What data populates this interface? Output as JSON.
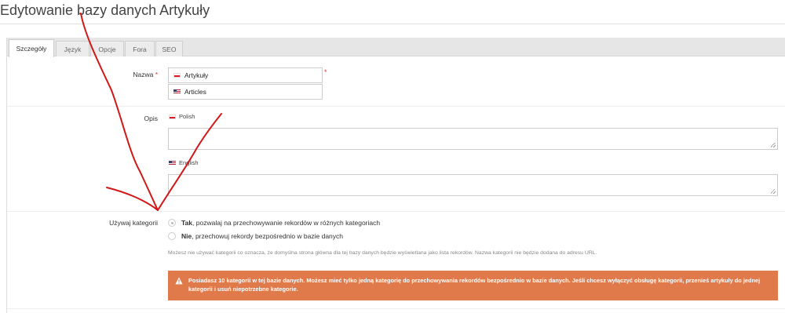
{
  "page": {
    "title": "Edytowanie bazy danych Artykuły"
  },
  "tabs": [
    {
      "label": "Szczegóły",
      "active": true
    },
    {
      "label": "Język"
    },
    {
      "label": "Opcje"
    },
    {
      "label": "Fora"
    },
    {
      "label": "SEO"
    }
  ],
  "name_field": {
    "label": "Nazwa",
    "required_mark": "*",
    "pl_value": "Artykuły",
    "en_value": "Articles"
  },
  "description_field": {
    "label": "Opis",
    "pl_lang": "Polish",
    "en_lang": "English"
  },
  "categories": {
    "label": "Używaj kategorii",
    "option_yes_bold": "Tak",
    "option_yes_rest": ", pozwalaj na przechowywanie rekordów w różnych kategoriach",
    "option_no_bold": "Nie",
    "option_no_rest": ", przechowuj rekordy bezpośrednio w bazie danych",
    "help": "Możesz nie używać kategorii co oznacza, że domyślna strona główna dla tej bazy danych będzie wyświetlana jako lista rekordów. Nazwa kategorii nie będzie dodana do adresu URL.",
    "warning": "Posiadasz 10 kategorii w tej bazie danych. Możesz mieć tylko jedną kategorię do przechowywania rekordów bezpośrednio w bazie danych. Jeśli chcesz wyłączyć obsługę kategorii, przenieś artykuły do jednej kategorii i usuń niepotrzebne kategorie."
  },
  "colors": {
    "warning_bg": "#e07a4b",
    "required": "#d33333",
    "annotation_arrow": "#d01818"
  }
}
